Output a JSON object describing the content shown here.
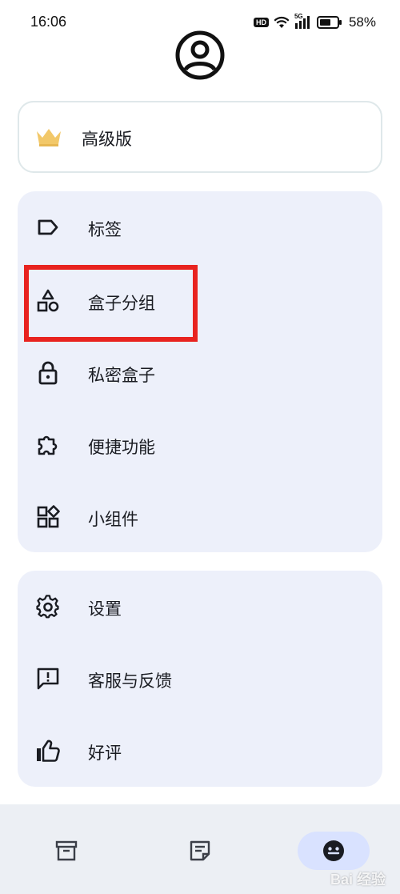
{
  "status_bar": {
    "time": "16:06",
    "hd_label": "HD",
    "network_label": "5G",
    "battery": "58%"
  },
  "avatar": {
    "icon": "account-circle-icon"
  },
  "premium": {
    "label": "高级版",
    "icon": "crown-icon",
    "icon_color": "#f2c869"
  },
  "menu_group_1": {
    "items": [
      {
        "label": "标签",
        "icon": "label-tag-icon"
      },
      {
        "label": "盒子分组",
        "icon": "shapes-category-icon"
      },
      {
        "label": "私密盒子",
        "icon": "lock-icon"
      },
      {
        "label": "便捷功能",
        "icon": "puzzle-extension-icon"
      },
      {
        "label": "小组件",
        "icon": "widgets-icon"
      }
    ]
  },
  "menu_group_2": {
    "items": [
      {
        "label": "设置",
        "icon": "gear-icon"
      },
      {
        "label": "客服与反馈",
        "icon": "feedback-chat-icon"
      },
      {
        "label": "好评",
        "icon": "thumb-up-icon"
      }
    ]
  },
  "bottom_nav": {
    "items": [
      {
        "icon": "archive-box-icon"
      },
      {
        "icon": "sticky-note-icon"
      },
      {
        "icon": "profile-face-icon",
        "active": true
      }
    ]
  },
  "watermark": {
    "text": "Bai 经验"
  },
  "colors": {
    "card_bg": "#edf0fa",
    "premium_border": "#dfe8ea",
    "highlight": "#e8231f",
    "nav_bg": "#eceff4",
    "nav_active": "#d9e2ff"
  }
}
